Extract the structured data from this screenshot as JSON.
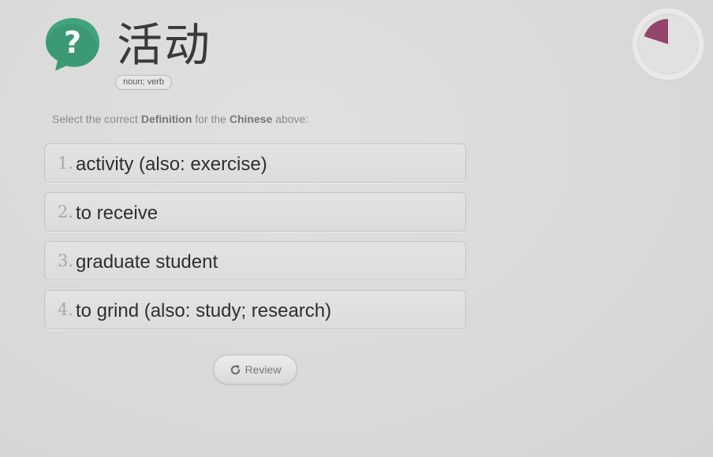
{
  "card": {
    "word": "活动",
    "part_of_speech": "noun; verb",
    "icon": "question-bubble-icon",
    "icon_color": "#3b9a73"
  },
  "instruction": {
    "prefix": "Select the correct ",
    "target": "Definition",
    "middle": " for the ",
    "source": "Chinese",
    "suffix": " above:"
  },
  "options": [
    {
      "number": "1.",
      "text": "activity (also: exercise)"
    },
    {
      "number": "2.",
      "text": "to receive"
    },
    {
      "number": "3.",
      "text": "graduate student"
    },
    {
      "number": "4.",
      "text": "to grind (also: study; research)"
    }
  ],
  "review_button": {
    "label": "Review",
    "icon": "refresh-icon"
  },
  "timer": {
    "elapsed_fraction": 0.2,
    "fill_color": "#93446b",
    "icon": "timer-pie-icon"
  }
}
